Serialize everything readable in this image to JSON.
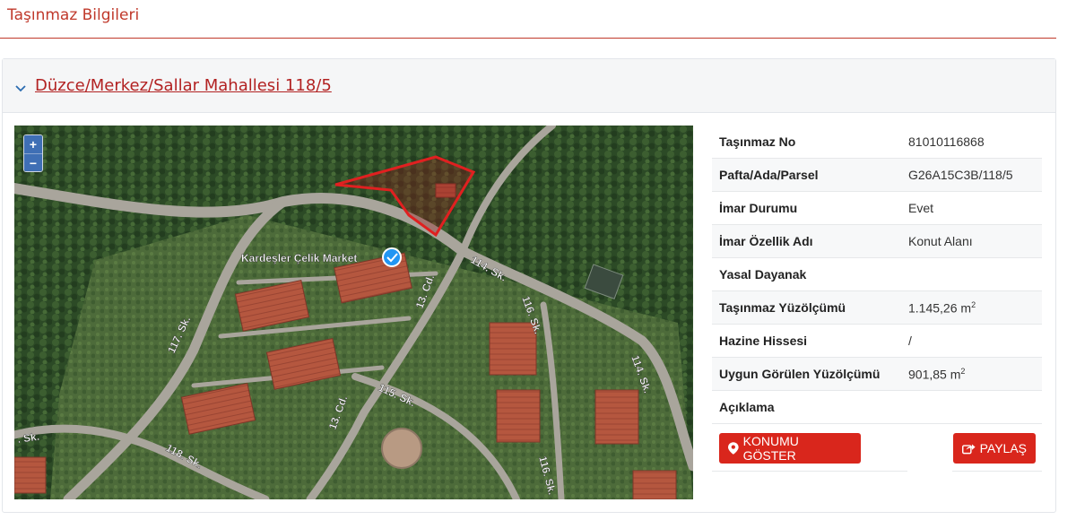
{
  "section": {
    "title": "Taşınmaz Bilgileri"
  },
  "panel": {
    "title": "Düzce/Merkez/Sallar Mahallesi 118/5"
  },
  "map": {
    "zoom_in": "+",
    "zoom_out": "−",
    "poi_label": "Kardeşler Çelik Market",
    "street_labels": [
      "114. Sk.",
      "116. Sk.",
      "117. Sk.",
      "114. Sk.",
      "13. Cd.",
      "115. Sk.",
      "13. Cd.",
      "118. Sk.",
      ". Sk.",
      "116. Sk."
    ]
  },
  "details": [
    {
      "key": "Taşınmaz No",
      "value": "81010116868",
      "unit": ""
    },
    {
      "key": "Pafta/Ada/Parsel",
      "value": "G26A15C3B/118/5",
      "unit": ""
    },
    {
      "key": "İmar Durumu",
      "value": "Evet",
      "unit": ""
    },
    {
      "key": "İmar Özellik Adı",
      "value": "Konut Alanı",
      "unit": ""
    },
    {
      "key": "Yasal Dayanak",
      "value": "",
      "unit": ""
    },
    {
      "key": "Taşınmaz Yüzölçümü",
      "value": "1.145,26 m",
      "unit": "2"
    },
    {
      "key": "Hazine Hissesi",
      "value": "/",
      "unit": ""
    },
    {
      "key": "Uygun Görülen Yüzölçümü",
      "value": "901,85 m",
      "unit": "2"
    },
    {
      "key": "Açıklama",
      "value": "",
      "unit": ""
    }
  ],
  "buttons": {
    "show_location": "KONUMU GÖSTER",
    "share": "PAYLAŞ"
  },
  "colors": {
    "accent": "#c0392b",
    "button": "#d9261c",
    "zoom": "#3f6fb5"
  }
}
